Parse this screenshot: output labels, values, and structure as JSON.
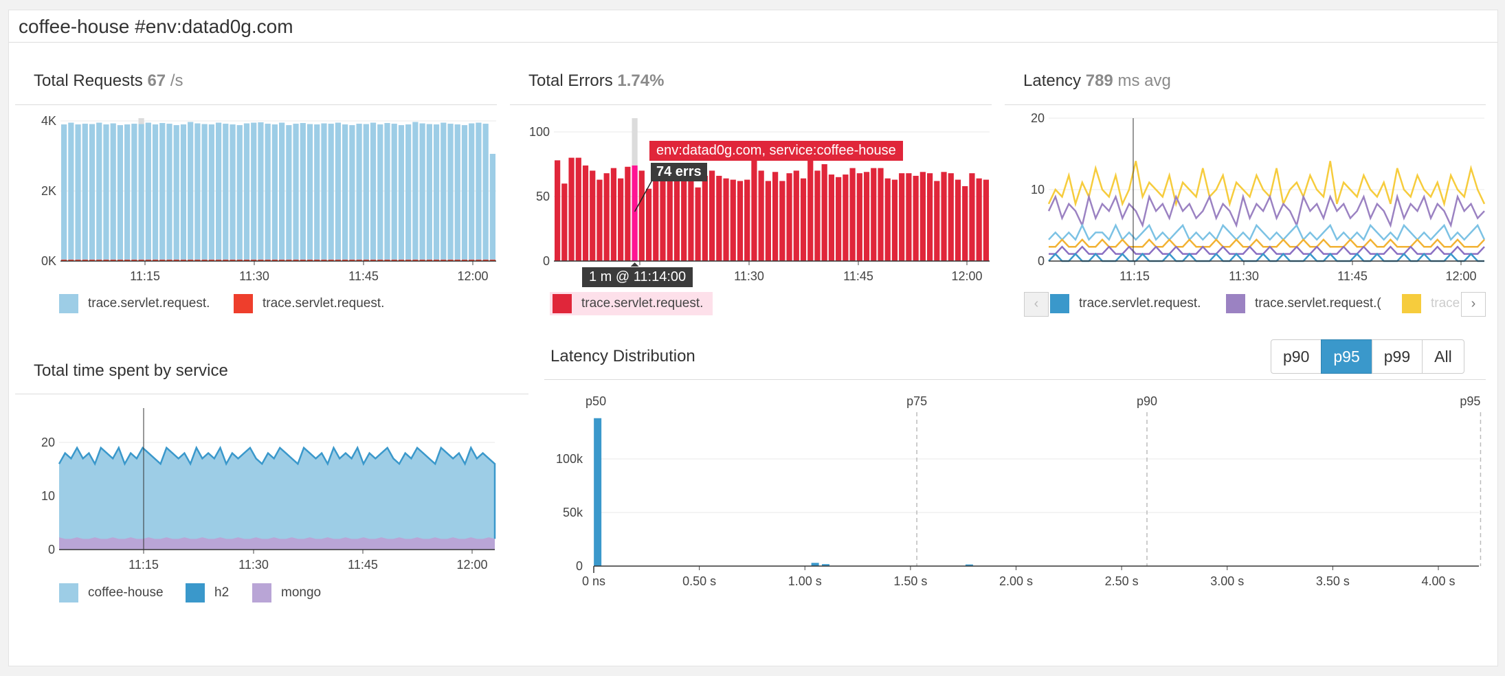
{
  "page": {
    "title": "coffee-house #env:datad0g.com"
  },
  "colors": {
    "light_blue": "#9dcde6",
    "blue": "#3a98cb",
    "red": "#e0263a",
    "orange_red": "#ee3e2c",
    "purple": "#9b82c2",
    "lavender": "#b9a5d6",
    "yellow": "#f6cc3d",
    "pink": "#ff1493",
    "grid": "#e8e8e8"
  },
  "widgets": {
    "requests": {
      "title": "Total Requests",
      "value": "67",
      "unit": "/s",
      "legend": [
        {
          "label": "trace.servlet.request.",
          "color": "#9dcde6"
        },
        {
          "label": "trace.servlet.request.",
          "color": "#ee3e2c"
        }
      ]
    },
    "errors": {
      "title": "Total Errors",
      "value": "1.74%",
      "legend": [
        {
          "label": "trace.servlet.request.",
          "color": "#e0263a"
        }
      ],
      "tooltip": {
        "series": "env:datad0g.com, service:coffee-house",
        "value": "74 errs",
        "time": "1 m @ 11:14:00"
      }
    },
    "latency": {
      "title": "Latency",
      "value": "789",
      "unit": "ms avg",
      "legend": [
        {
          "label": "trace.servlet.request.",
          "color": "#3a98cb"
        },
        {
          "label": "trace.servlet.request.(",
          "color": "#9b82c2"
        },
        {
          "label": "trace",
          "color": "#f6cc3d"
        }
      ],
      "prev_icon": "‹",
      "next_icon": "›"
    },
    "time_spent": {
      "title": "Total time spent by service",
      "legend": [
        {
          "label": "coffee-house",
          "color": "#9dcde6"
        },
        {
          "label": "h2",
          "color": "#3a98cb"
        },
        {
          "label": "mongo",
          "color": "#b9a5d6"
        }
      ]
    },
    "distribution": {
      "title": "Latency Distribution",
      "buttons": [
        "p90",
        "p95",
        "p99",
        "All"
      ],
      "active": "p95"
    }
  },
  "chart_data": [
    {
      "id": "total-requests",
      "type": "bar",
      "x_ticks": [
        "11:15",
        "11:30",
        "11:45",
        "12:00"
      ],
      "y_ticks": [
        "0K",
        "2K",
        "4K"
      ],
      "ylim": [
        0,
        5000
      ],
      "series": [
        {
          "values": [
            3900,
            3950,
            3900,
            3920,
            3910,
            3950,
            3900,
            3930,
            3880,
            3900,
            3920,
            3910,
            3950,
            3900,
            3940,
            3920,
            3880,
            3900,
            3970,
            3930,
            3910,
            3900,
            3950,
            3920,
            3900,
            3880,
            3930,
            3950,
            3960,
            3920,
            3900,
            3950,
            3880,
            3920,
            3940,
            3910,
            3900,
            3930,
            3920,
            3950,
            3900,
            3880,
            3920,
            3910,
            3950,
            3900,
            3940,
            3920,
            3880,
            3900,
            3970,
            3930,
            3910,
            3900,
            3950,
            3920,
            3900,
            3880,
            3930,
            3950,
            3920,
            3060
          ]
        },
        {
          "values": [
            40,
            40,
            40,
            40,
            40,
            40,
            40,
            40,
            40,
            40,
            40,
            40,
            40,
            40,
            40,
            40,
            40,
            40,
            40,
            40,
            40,
            40,
            40,
            40,
            40,
            40,
            40,
            40,
            40,
            40,
            40,
            40,
            40,
            40,
            40,
            40,
            40,
            40,
            40,
            40,
            40,
            40,
            40,
            40,
            40,
            40,
            40,
            40,
            40,
            40,
            40,
            40,
            40,
            40,
            40,
            40,
            40,
            40,
            40,
            40,
            40,
            40
          ]
        }
      ],
      "highlight_index": 11
    },
    {
      "id": "total-errors",
      "type": "bar",
      "x_ticks": [
        "11:15",
        "11:30",
        "11:45",
        "12:00"
      ],
      "y_ticks": [
        "0",
        "50",
        "100"
      ],
      "ylim": [
        0,
        100
      ],
      "series": [
        {
          "values": [
            78,
            60,
            80,
            80,
            74,
            70,
            63,
            68,
            72,
            64,
            73,
            74,
            70,
            56,
            67,
            66,
            73,
            67,
            64,
            75,
            57,
            66,
            70,
            66,
            64,
            63,
            62,
            63,
            80,
            70,
            62,
            69,
            62,
            68,
            70,
            64,
            78,
            70,
            75,
            67,
            65,
            67,
            72,
            68,
            69,
            72,
            72,
            64,
            63,
            68,
            68,
            66,
            69,
            68,
            62,
            69,
            68,
            63,
            58,
            68,
            64,
            63
          ]
        }
      ],
      "highlight_index": 11
    },
    {
      "id": "latency",
      "type": "line",
      "x_ticks": [
        "11:15",
        "11:30",
        "11:45",
        "12:00"
      ],
      "y_ticks": [
        "0",
        "10",
        "20"
      ],
      "ylim": [
        0,
        20
      ],
      "series": [
        {
          "name": "yellow",
          "values": [
            8,
            10,
            9,
            12,
            8,
            11,
            9,
            13,
            10,
            9,
            12,
            8,
            10,
            14,
            9,
            11,
            10,
            9,
            12,
            8,
            11,
            10,
            9,
            13,
            9,
            10,
            12,
            8,
            11,
            10,
            9,
            12,
            10,
            9,
            13,
            8,
            10,
            11,
            9,
            12,
            10,
            9,
            14,
            8,
            11,
            10,
            9,
            12,
            10,
            9,
            11,
            8,
            13,
            10,
            9,
            12,
            10,
            9,
            11,
            8,
            12,
            10,
            9,
            13,
            10,
            8
          ]
        },
        {
          "name": "purple",
          "values": [
            7,
            9,
            6,
            8,
            7,
            5,
            9,
            6,
            8,
            7,
            9,
            6,
            8,
            7,
            5,
            9,
            7,
            8,
            6,
            9,
            7,
            8,
            6,
            7,
            9,
            6,
            8,
            7,
            5,
            9,
            6,
            8,
            7,
            9,
            6,
            8,
            7,
            5,
            9,
            7,
            8,
            6,
            9,
            7,
            8,
            6,
            7,
            9,
            6,
            8,
            7,
            5,
            9,
            6,
            8,
            7,
            9,
            6,
            8,
            7,
            5,
            9,
            7,
            8,
            6,
            7
          ]
        },
        {
          "name": "light_blue",
          "values": [
            3,
            4,
            3,
            4,
            3,
            5,
            3,
            4,
            4,
            3,
            5,
            3,
            4,
            3,
            4,
            5,
            3,
            4,
            3,
            4,
            5,
            3,
            4,
            3,
            4,
            3,
            5,
            4,
            3,
            4,
            3,
            5,
            4,
            3,
            4,
            3,
            4,
            5,
            3,
            4,
            3,
            4,
            5,
            3,
            4,
            3,
            4,
            3,
            5,
            4,
            3,
            4,
            3,
            5,
            4,
            3,
            4,
            3,
            4,
            5,
            3,
            4,
            3,
            4,
            5,
            3
          ]
        },
        {
          "name": "gold",
          "values": [
            2,
            2,
            3,
            2,
            2,
            3,
            2,
            2,
            3,
            2,
            2,
            3,
            2,
            2,
            2,
            3,
            2,
            2,
            3,
            2,
            2,
            3,
            2,
            2,
            2,
            3,
            2,
            2,
            3,
            2,
            2,
            3,
            2,
            2,
            2,
            3,
            2,
            2,
            3,
            2,
            2,
            3,
            2,
            2,
            2,
            3,
            2,
            2,
            3,
            2,
            2,
            3,
            2,
            2,
            2,
            3,
            2,
            2,
            3,
            2,
            2,
            3,
            2,
            2,
            2,
            3
          ]
        },
        {
          "name": "violet",
          "values": [
            1,
            1,
            2,
            1,
            1,
            2,
            1,
            1,
            1,
            2,
            1,
            1,
            2,
            1,
            1,
            1,
            2,
            1,
            1,
            2,
            1,
            1,
            1,
            2,
            1,
            1,
            2,
            1,
            1,
            1,
            2,
            1,
            1,
            2,
            1,
            1,
            1,
            2,
            1,
            1,
            2,
            1,
            1,
            1,
            2,
            1,
            1,
            2,
            1,
            1,
            1,
            2,
            1,
            1,
            2,
            1,
            1,
            1,
            2,
            1,
            1,
            2,
            1,
            1,
            1,
            2
          ]
        },
        {
          "name": "blue",
          "values": [
            0,
            1,
            0,
            0,
            1,
            0,
            0,
            1,
            0,
            0,
            0,
            1,
            0,
            0,
            1,
            0,
            0,
            0,
            1,
            0,
            0,
            1,
            0,
            0,
            0,
            1,
            0,
            0,
            1,
            0,
            0,
            0,
            1,
            0,
            0,
            1,
            0,
            0,
            0,
            1,
            0,
            0,
            1,
            0,
            0,
            0,
            1,
            0,
            0,
            1,
            0,
            0,
            0,
            1,
            0,
            0,
            1,
            0,
            0,
            0,
            1,
            0,
            0,
            1,
            0,
            0
          ]
        }
      ]
    },
    {
      "id": "time-spent",
      "type": "area",
      "x_ticks": [
        "11:15",
        "11:30",
        "11:45",
        "12:00"
      ],
      "y_ticks": [
        "0",
        "10",
        "20"
      ],
      "ylim": [
        0,
        25
      ],
      "series": [
        {
          "name": "coffee-house",
          "values": [
            16,
            18,
            17,
            19,
            17,
            18,
            16,
            19,
            18,
            17,
            19,
            16,
            18,
            17,
            19,
            18,
            17,
            16,
            19,
            18,
            17,
            18,
            16,
            19,
            17,
            18,
            17,
            19,
            16,
            18,
            17,
            18,
            19,
            17,
            16,
            18,
            17,
            19,
            18,
            17,
            16,
            19,
            18,
            17,
            18,
            16,
            19,
            17,
            18,
            17,
            19,
            16,
            18,
            17,
            18,
            19,
            17,
            16,
            18,
            17,
            19,
            18,
            17,
            16,
            19,
            18,
            17,
            18,
            16,
            19,
            17,
            18,
            17,
            16
          ]
        },
        {
          "name": "mongo",
          "values": [
            2,
            2,
            2,
            2,
            2,
            2,
            2,
            2,
            2,
            2,
            2,
            2,
            2,
            2,
            2,
            2,
            2,
            2,
            2,
            2,
            2,
            2,
            2,
            2,
            2,
            2,
            2,
            2,
            2,
            2,
            2,
            2,
            2,
            2,
            2,
            2,
            2,
            2,
            2,
            2,
            2,
            2,
            2,
            2,
            2,
            2,
            2,
            2,
            2,
            2,
            2,
            2,
            2,
            2,
            2,
            2,
            2,
            2,
            2,
            2,
            2,
            2,
            2,
            2,
            2,
            2,
            2,
            2,
            2,
            2,
            2,
            2,
            2,
            2
          ]
        }
      ]
    },
    {
      "id": "latency-distribution",
      "type": "bar",
      "x_ticks": [
        "0 ns",
        "0.50 s",
        "1.00 s",
        "1.50 s",
        "2.00 s",
        "2.50 s",
        "3.00 s",
        "3.50 s",
        "4.00 s"
      ],
      "y_ticks": [
        "0",
        "50k",
        "100k"
      ],
      "ylim": [
        0,
        150000
      ],
      "markers": [
        {
          "label": "p50",
          "x": 0.01
        },
        {
          "label": "p75",
          "x": 1.53
        },
        {
          "label": "p90",
          "x": 2.62
        },
        {
          "label": "p95",
          "x": 4.2
        }
      ],
      "points": [
        {
          "x": 0.02,
          "y": 138000
        },
        {
          "x": 1.05,
          "y": 3000
        },
        {
          "x": 1.1,
          "y": 1800
        },
        {
          "x": 1.78,
          "y": 1500
        }
      ]
    }
  ]
}
